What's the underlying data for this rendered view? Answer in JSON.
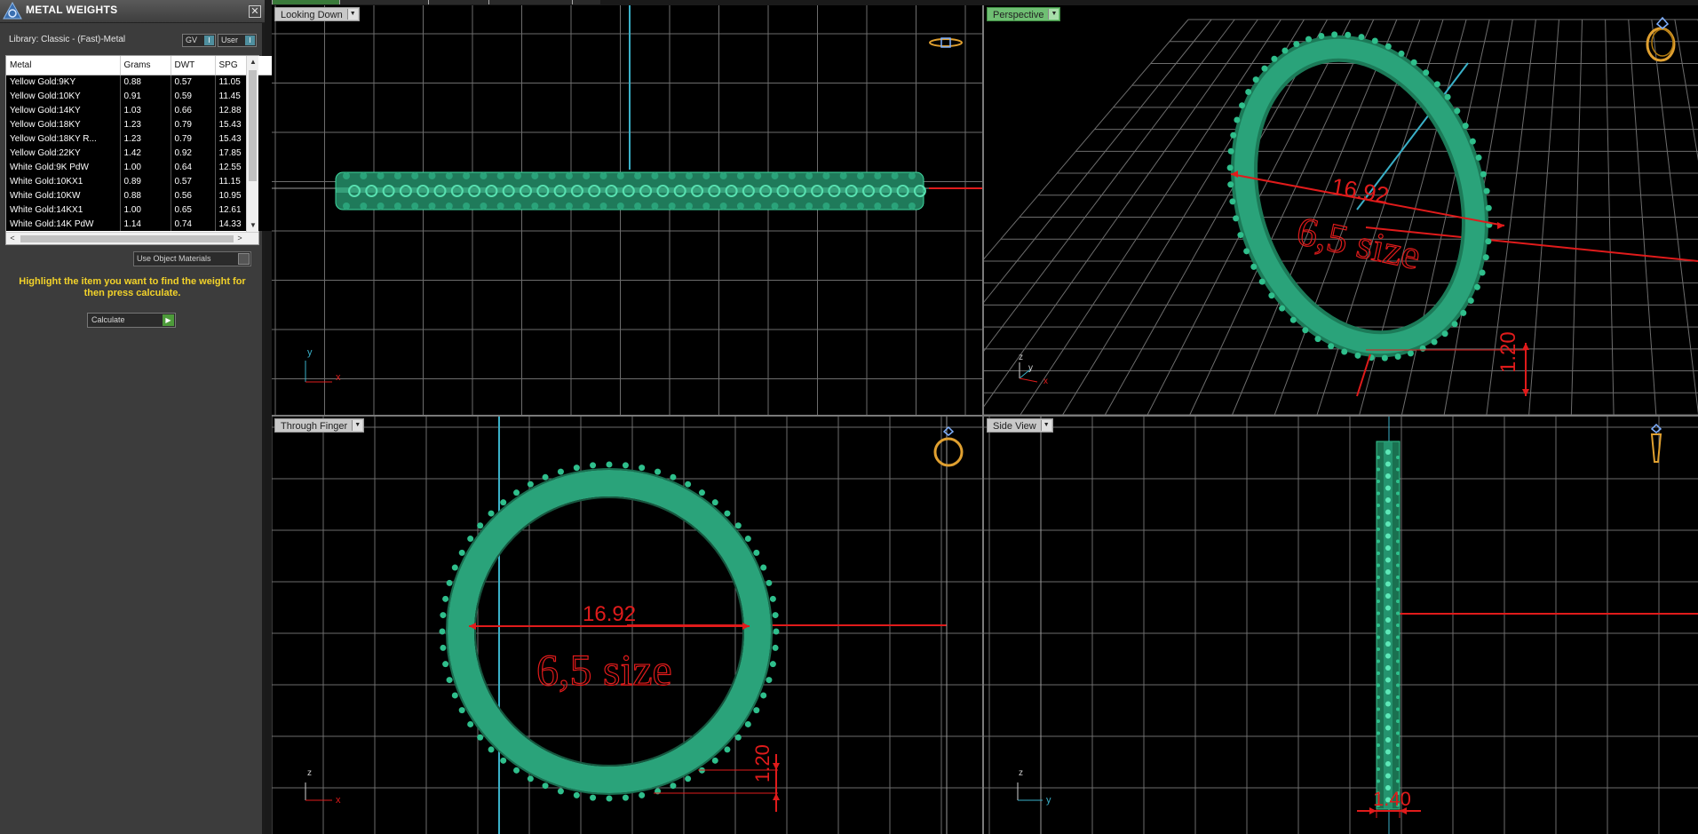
{
  "panel": {
    "title": "METAL WEIGHTS",
    "close": "✕",
    "library_label": "Library: Classic - (Fast)-Metal",
    "toggles": [
      {
        "label": "GV",
        "icon": "I"
      },
      {
        "label": "User",
        "icon": "I"
      }
    ],
    "table": {
      "headers": [
        "Metal",
        "Grams",
        "DWT",
        "SPG"
      ],
      "rows": [
        [
          "Yellow Gold:9KY",
          "0.88",
          "0.57",
          "11.05"
        ],
        [
          "Yellow Gold:10KY",
          "0.91",
          "0.59",
          "11.45"
        ],
        [
          "Yellow Gold:14KY",
          "1.03",
          "0.66",
          "12.88"
        ],
        [
          "Yellow Gold:18KY",
          "1.23",
          "0.79",
          "15.43"
        ],
        [
          "Yellow Gold:18KY R...",
          "1.23",
          "0.79",
          "15.43"
        ],
        [
          "Yellow Gold:22KY",
          "1.42",
          "0.92",
          "17.85"
        ],
        [
          "White Gold:9K PdW",
          "1.00",
          "0.64",
          "12.55"
        ],
        [
          "White Gold:10KX1",
          "0.89",
          "0.57",
          "11.15"
        ],
        [
          "White Gold:10KW",
          "0.88",
          "0.56",
          "10.95"
        ],
        [
          "White Gold:14KX1",
          "1.00",
          "0.65",
          "12.61"
        ],
        [
          "White Gold:14K PdW",
          "1.14",
          "0.74",
          "14.33"
        ]
      ]
    },
    "use_object_materials": "Use Object Materials",
    "hint": "Highlight the item you want to find the weight for then press calculate.",
    "calculate": "Calculate"
  },
  "viewports": {
    "top_left": {
      "label": "Looking Down",
      "axis_v": "y",
      "axis_h": "x"
    },
    "top_right": {
      "label": "Perspective",
      "axis_v": "z",
      "axis_a": "y",
      "axis_h": "x",
      "dim_diameter": "16.92",
      "dim_height": "1.20",
      "size_text": "6,5 size"
    },
    "bottom_left": {
      "label": "Through Finger",
      "axis_v": "z",
      "axis_h": "x",
      "dim_diameter": "16.92",
      "dim_thickness": "1.20",
      "size_text": "6,5 size"
    },
    "bottom_right": {
      "label": "Side View",
      "axis_v": "z",
      "axis_h": "y",
      "dim_width": "1.40"
    }
  },
  "colors": {
    "metal": "#2aa37a",
    "dimension": "#e01b1b",
    "grid": "#6d6d6d",
    "axis_cyan": "#3ab0c8",
    "hint": "#f2d22a",
    "ring_icon": "#e0a030"
  }
}
